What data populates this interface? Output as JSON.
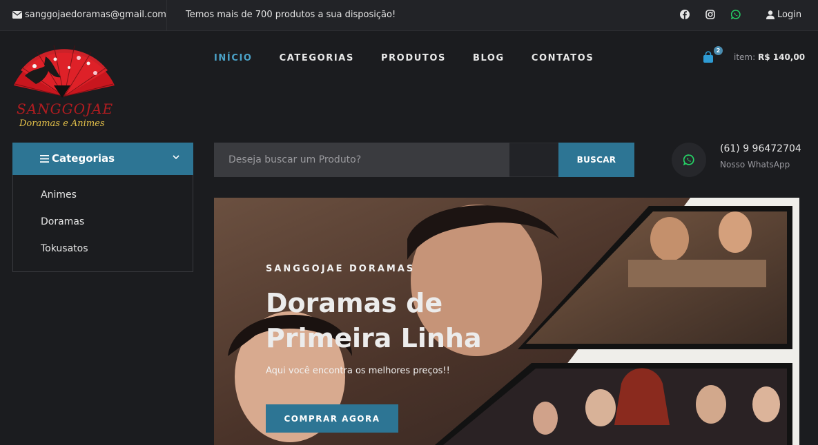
{
  "topbar": {
    "email": "sanggojaedoramas@gmail.com",
    "promo": "Temos mais de 700 produtos a sua disposição!",
    "social_icons": [
      "facebook-icon",
      "instagram-icon",
      "whatsapp-icon"
    ],
    "login_label": "Login"
  },
  "logo": {
    "text": "SANGGOJAE",
    "tagline": "Doramas e Animes"
  },
  "nav": {
    "items": [
      {
        "label": "INÍCIO",
        "active": true
      },
      {
        "label": "CATEGORIAS",
        "active": false
      },
      {
        "label": "PRODUTOS",
        "active": false
      },
      {
        "label": "BLOG",
        "active": false
      },
      {
        "label": "CONTATOS",
        "active": false
      }
    ]
  },
  "cart": {
    "count": "2",
    "total_prefix": "item:",
    "total": "R$ 140,00"
  },
  "categories": {
    "title": "Categorias",
    "items": [
      "Animes",
      "Doramas",
      "Tokusatos"
    ]
  },
  "search": {
    "placeholder": "Deseja buscar um Produto?",
    "button": "BUSCAR"
  },
  "whatsapp": {
    "phone": "(61) 9 96472704",
    "label": "Nosso WhatsApp"
  },
  "hero": {
    "kicker": "SANGGOJAE DORAMAS",
    "title": "Doramas de Primeira Linha",
    "subtitle": "Aqui você encontra os melhores preços!!",
    "cta": "COMPRAR AGORA"
  },
  "colors": {
    "accent": "#2d7594",
    "active_nav": "#4ba3c9",
    "background": "#1b1c1f",
    "whatsapp": "#25d366"
  }
}
